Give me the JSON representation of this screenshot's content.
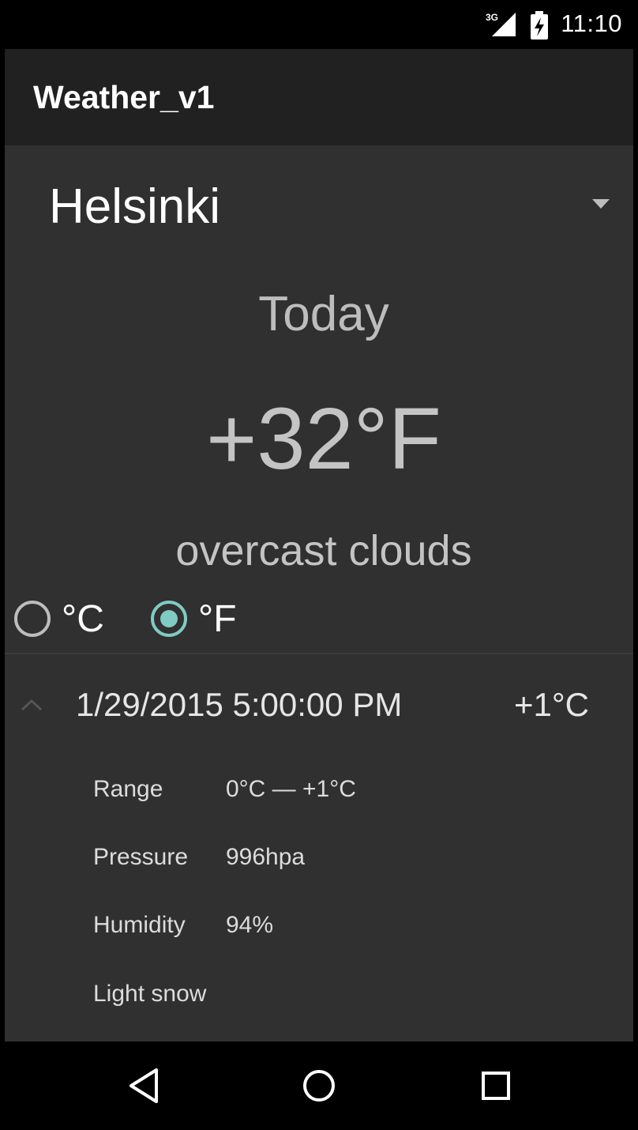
{
  "status_bar": {
    "network_label": "3G",
    "time": "11:10",
    "icons": [
      "signal-icon",
      "battery-charging-icon"
    ]
  },
  "app": {
    "title": "Weather_v1"
  },
  "city_spinner": {
    "selected": "Helsinki"
  },
  "current": {
    "day_label": "Today",
    "temperature": "+32°F",
    "condition": "overcast clouds"
  },
  "units": {
    "options": [
      {
        "label": "°C",
        "checked": false
      },
      {
        "label": "°F",
        "checked": true
      }
    ]
  },
  "forecast": {
    "expanded": true,
    "datetime": "1/29/2015 5:00:00 PM",
    "temperature": "+1°C",
    "details": {
      "range_label": "Range",
      "range_value": "0°C — +1°C",
      "pressure_label": "Pressure",
      "pressure_value": "996hpa",
      "humidity_label": "Humidity",
      "humidity_value": "94%",
      "description": "Light snow"
    }
  },
  "nav_bar": {
    "buttons": [
      "back-icon",
      "home-icon",
      "recents-icon"
    ]
  },
  "colors": {
    "background": "#303030",
    "action_bar": "#212121",
    "accent": "#80cbc4",
    "primary_text": "#ffffff",
    "secondary_text": "#bdbdbd"
  }
}
